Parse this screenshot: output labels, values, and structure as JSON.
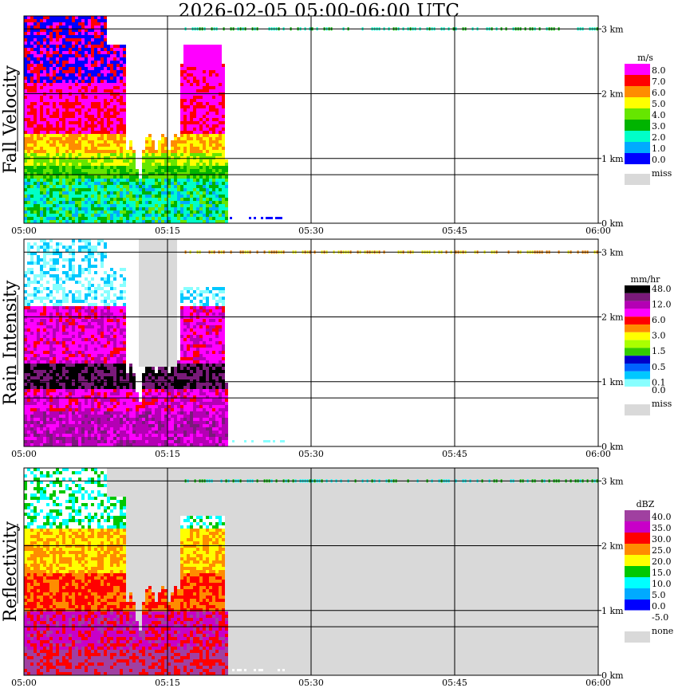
{
  "title": "2026-02-05   05:00-06:00 UTC",
  "chart_data": [
    {
      "type": "heatmap",
      "title": "",
      "ylabel": "Fall Velocity",
      "x_ticks": [
        "05:00",
        "05:15",
        "05:30",
        "05:45",
        "06:00"
      ],
      "y_ticks": [
        "0 km",
        "1 km",
        "2 km",
        "3 km"
      ],
      "ylim": [
        0,
        3.2
      ],
      "xlim_minutes": [
        0,
        60
      ],
      "legend_unit": "m/s",
      "legend": [
        {
          "label": "8.0",
          "color": "#ff00ff"
        },
        {
          "label": "7.0",
          "color": "#ff0000"
        },
        {
          "label": "6.0",
          "color": "#ff8c00"
        },
        {
          "label": "5.0",
          "color": "#ffff00"
        },
        {
          "label": "4.0",
          "color": "#66e600"
        },
        {
          "label": "3.0",
          "color": "#00b400"
        },
        {
          "label": "2.0",
          "color": "#00ffc8"
        },
        {
          "label": "1.0",
          "color": "#00aaff"
        },
        {
          "label": "0.0",
          "color": "#0000ff"
        }
      ],
      "miss_label": "miss",
      "miss_color": "#d9d9d9",
      "background": "#ffffff"
    },
    {
      "type": "heatmap",
      "title": "",
      "ylabel": "Rain Intensity",
      "x_ticks": [
        "05:00",
        "05:15",
        "05:30",
        "05:45",
        "06:00"
      ],
      "y_ticks": [
        "0 km",
        "1 km",
        "2 km",
        "3 km"
      ],
      "ylim": [
        0,
        3.2
      ],
      "xlim_minutes": [
        0,
        60
      ],
      "legend_unit": "mm/hr",
      "legend": [
        {
          "label": "48.0",
          "color": "#000000"
        },
        {
          "label": "",
          "color": "#7a1a7a"
        },
        {
          "label": "12.0",
          "color": "#b400b4"
        },
        {
          "label": "",
          "color": "#ff00ff"
        },
        {
          "label": "6.0",
          "color": "#ff0000"
        },
        {
          "label": "",
          "color": "#ff8c00"
        },
        {
          "label": "3.0",
          "color": "#ffff00"
        },
        {
          "label": "",
          "color": "#aaff00"
        },
        {
          "label": "1.5",
          "color": "#33cc00"
        },
        {
          "label": "",
          "color": "#0000c8"
        },
        {
          "label": "0.5",
          "color": "#0064ff"
        },
        {
          "label": "",
          "color": "#00c8ff"
        },
        {
          "label": "0.1",
          "color": "#88ffff"
        },
        {
          "label": "0.0",
          "color": "#ffffff"
        }
      ],
      "miss_label": "miss",
      "miss_color": "#d9d9d9",
      "background": "#ffffff"
    },
    {
      "type": "heatmap",
      "title": "",
      "ylabel": "Reflectivity",
      "x_ticks": [
        "05:00",
        "05:15",
        "05:30",
        "05:45",
        "06:00"
      ],
      "y_ticks": [
        "0 km",
        "1 km",
        "2 km",
        "3 km"
      ],
      "ylim": [
        0,
        3.2
      ],
      "xlim_minutes": [
        0,
        60
      ],
      "legend_unit": "dBZ",
      "legend": [
        {
          "label": "40.0",
          "color": "#a040a0"
        },
        {
          "label": "35.0",
          "color": "#c800c8"
        },
        {
          "label": "30.0",
          "color": "#ff0000"
        },
        {
          "label": "25.0",
          "color": "#ff8c00"
        },
        {
          "label": "20.0",
          "color": "#ffff00"
        },
        {
          "label": "15.0",
          "color": "#00c800"
        },
        {
          "label": "10.0",
          "color": "#00ffff"
        },
        {
          "label": "5.0",
          "color": "#00aaff"
        },
        {
          "label": "0.0",
          "color": "#0000ff"
        },
        {
          "label": "-5.0",
          "color": "#ffffff"
        }
      ],
      "miss_label": "none",
      "miss_color": "#d9d9d9",
      "background": "#d9d9d9"
    }
  ]
}
